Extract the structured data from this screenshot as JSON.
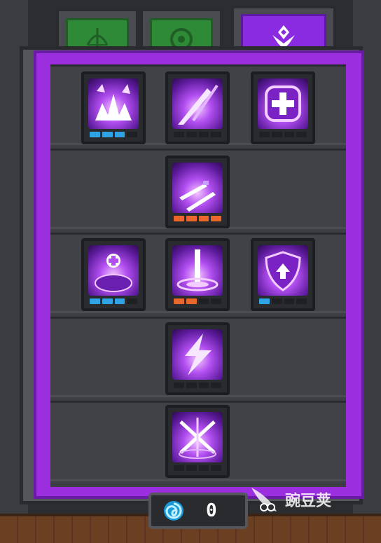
{
  "tabs": [
    {
      "id": "tab-bow",
      "icon": "bow-icon",
      "active": false
    },
    {
      "id": "tab-ring",
      "icon": "ring-icon",
      "active": false
    },
    {
      "id": "tab-crest",
      "icon": "crest-icon",
      "active": true
    }
  ],
  "colors": {
    "tab_inactive": "#2f8a37",
    "tab_active": "#8a2be2",
    "frame_purple": "#9b2fe0",
    "bar_blue": "#2ea3e6",
    "bar_orange": "#e9672b",
    "bar_empty": "#1f2023"
  },
  "skills": [
    {
      "name": "skill-burst",
      "icon": "spike-burst-icon",
      "level": 3,
      "max": 4,
      "bar_color": "blue"
    },
    {
      "name": "skill-slash",
      "icon": "slash-icon",
      "level": 0,
      "max": 4,
      "bar_color": "blue"
    },
    {
      "name": "skill-heal",
      "icon": "plus-cross-icon",
      "level": 0,
      "max": 4,
      "bar_color": "blue"
    },
    {
      "name": "skill-flying-swords",
      "icon": "flying-swords-icon",
      "level": 4,
      "max": 4,
      "bar_color": "orange"
    },
    {
      "name": "skill-pet-heal",
      "icon": "pet-heal-icon",
      "level": 3,
      "max": 4,
      "bar_color": "blue"
    },
    {
      "name": "skill-sword-pillar",
      "icon": "sword-pillar-icon",
      "level": 2,
      "max": 4,
      "bar_color": "orange"
    },
    {
      "name": "skill-shield-up",
      "icon": "shield-up-icon",
      "level": 1,
      "max": 4,
      "bar_color": "blue"
    },
    {
      "name": "skill-lightning",
      "icon": "lightning-icon",
      "level": 0,
      "max": 4,
      "bar_color": "blue"
    },
    {
      "name": "skill-sword-ring",
      "icon": "sword-ring-icon",
      "level": 0,
      "max": 4,
      "bar_color": "blue"
    }
  ],
  "currency": {
    "icon": "spiral-gem-icon",
    "count": "0"
  },
  "watermark": {
    "text": "豌豆荚"
  }
}
